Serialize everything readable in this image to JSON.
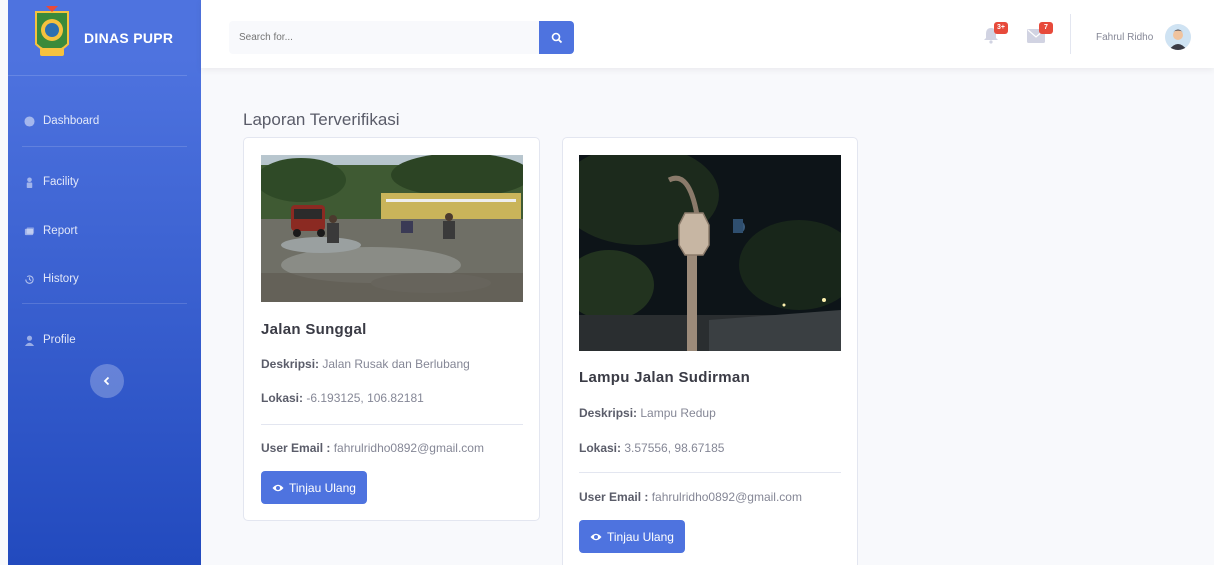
{
  "app": {
    "brand": "DINAS PUPR",
    "accent": "#4e73df",
    "sidebar_gradient": [
      "#4e73df",
      "#224abe"
    ]
  },
  "sidebar": {
    "items": [
      {
        "label": "Dashboard",
        "icon": "palette-icon"
      },
      {
        "label": "Facility",
        "icon": "person-icon"
      },
      {
        "label": "Report",
        "icon": "folders-icon"
      },
      {
        "label": "History",
        "icon": "history-icon"
      },
      {
        "label": "Profile",
        "icon": "user-icon"
      }
    ],
    "toggle_icon": "chevron-left-icon"
  },
  "topbar": {
    "search_placeholder": "Search for...",
    "alerts_badge": "3+",
    "messages_badge": "7",
    "user_name": "Fahrul Ridho"
  },
  "main": {
    "title": "Laporan Terverifikasi",
    "reports": [
      {
        "title": "Jalan Sunggal",
        "desc_label": "Deskripsi:",
        "desc": " Jalan Rusak dan Berlubang",
        "loc_label": "Lokasi:",
        "loc": " -6.193125, 106.82181",
        "email_label": "User Email :",
        "email": " fahrulridho0892@gmail.com",
        "button": "Tinjau Ulang"
      },
      {
        "title": "Lampu Jalan Sudirman",
        "desc_label": "Deskripsi:",
        "desc": " Lampu Redup",
        "loc_label": "Lokasi:",
        "loc": " 3.57556, 98.67185",
        "email_label": "User Email :",
        "email": " fahrulridho0892@gmail.com",
        "button": "Tinjau Ulang"
      }
    ]
  }
}
